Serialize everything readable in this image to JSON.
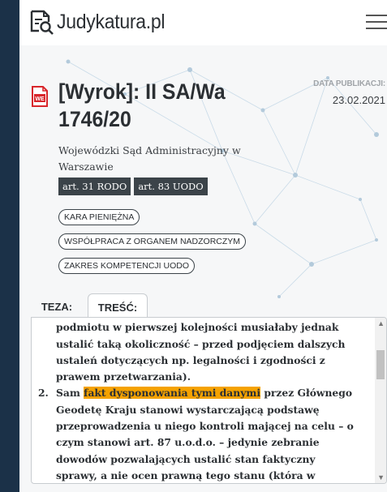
{
  "header": {
    "logo_text": "Judykatura.pl",
    "logo_icon": "document-search-icon",
    "menu_icon": "hamburger-menu-icon"
  },
  "document": {
    "type_icon": "word-document-icon",
    "title": "[Wyrok]: II SA/Wa 1746/20",
    "pub_label": "DATA PUBLIKACJI:",
    "pub_date": "23.02.2021",
    "court": "Wojewódzki Sąd Administracyjny w Warszawie",
    "articles": [
      "art. 31 RODO",
      "art. 83 UODO"
    ],
    "keywords": [
      "KARA PIENIĘŻNA",
      "WSPÓŁPRACA Z ORGANEM NADZORCZYM",
      "ZAKRES KOMPETENCJI UODO"
    ]
  },
  "tabs": {
    "teza": "TEZA:",
    "tresc": "TREŚĆ:"
  },
  "content": {
    "item1_lines": [
      "podmiotu w pierwszej kolejności musiałaby jednak",
      "ustalić taką okoliczność – przed podjęciem dalszych",
      "ustaleń dotyczących np. legalności i zgodności z",
      "prawem przetwarzania)."
    ],
    "item2_num": "2.",
    "item2_before": "Sam ",
    "item2_highlight": "fakt dysponowania tymi danymi",
    "item2_after": " przez Głównego",
    "item2_lines": [
      "Geodetę Kraju stanowi wystarczającą podstawę",
      "przeprowadzenia u niego kontroli mającej na celu – o",
      "czym stanowi art. 87 u.o.d.o. – jedynie zebranie",
      "dowodów pozwalających ustalić stan faktyczny",
      "sprawy, a nie ocen prawną tego stanu (która w"
    ],
    "highlight_color": "#f5a200"
  },
  "colors": {
    "page_bg": "#1b3148",
    "tag_bg": "#3b4349",
    "network_lines": "#c9dbe8"
  }
}
